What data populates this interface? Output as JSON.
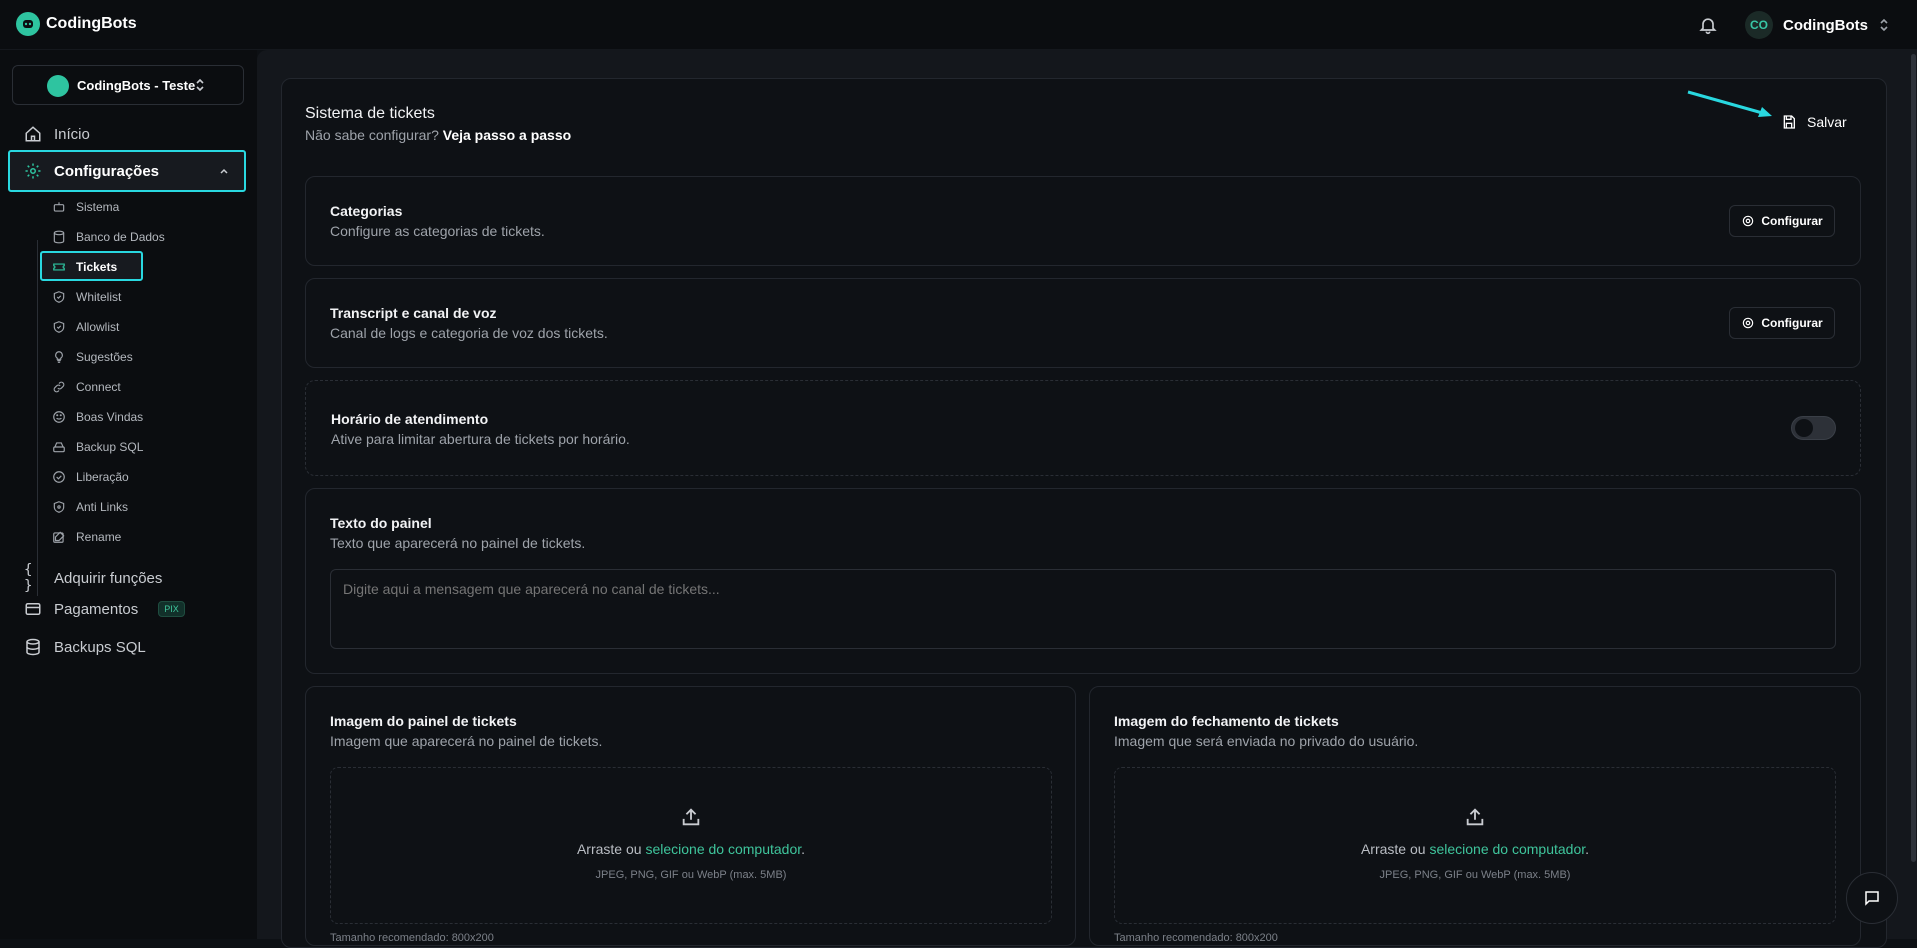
{
  "app": {
    "name": "CodingBots"
  },
  "user": {
    "initials": "CO",
    "name": "CodingBots"
  },
  "server": {
    "name": "CodingBots - Teste"
  },
  "nav": {
    "inicio": "Início",
    "config": "Configurações",
    "sub": [
      "Sistema",
      "Banco de Dados",
      "Tickets",
      "Whitelist",
      "Allowlist",
      "Sugestões",
      "Connect",
      "Boas Vindas",
      "Backup SQL",
      "Liberação",
      "Anti Links",
      "Rename"
    ],
    "adquirir": "Adquirir funções",
    "pagamentos": "Pagamentos",
    "pix_badge": "PIX",
    "backups": "Backups SQL"
  },
  "page": {
    "title": "Sistema de tickets",
    "help_prefix": "Não sabe configurar?",
    "help_link": "Veja passo a passo",
    "save_label": "Salvar"
  },
  "cards": {
    "categorias": {
      "title": "Categorias",
      "subtitle": "Configure as categorias de tickets.",
      "button": "Configurar"
    },
    "transcript": {
      "title": "Transcript e canal de voz",
      "subtitle": "Canal de logs e categoria de voz dos tickets.",
      "button": "Configurar"
    },
    "horario": {
      "title": "Horário de atendimento",
      "subtitle": "Ative para limitar abertura de tickets por horário.",
      "enabled": false
    },
    "texto": {
      "title": "Texto do painel",
      "subtitle": "Texto que aparecerá no painel de tickets.",
      "placeholder": "Digite aqui a mensagem que aparecerá no canal de tickets..."
    },
    "imagem_painel": {
      "title": "Imagem do painel de tickets",
      "subtitle": "Imagem que aparecerá no painel de tickets."
    },
    "imagem_fechamento": {
      "title": "Imagem do fechamento de tickets",
      "subtitle": "Imagem que será enviada no privado do usuário."
    }
  },
  "upload": {
    "drag_prefix": "Arraste ou",
    "select_link": "selecione do computador",
    "period": ".",
    "formats": "JPEG, PNG, GIF ou WebP (max. 5MB)",
    "recommended": "Tamanho recomendado: 800x200"
  },
  "colors": {
    "accent": "#2ec4a0",
    "highlight": "#29d8e0",
    "background": "#0d1014"
  }
}
